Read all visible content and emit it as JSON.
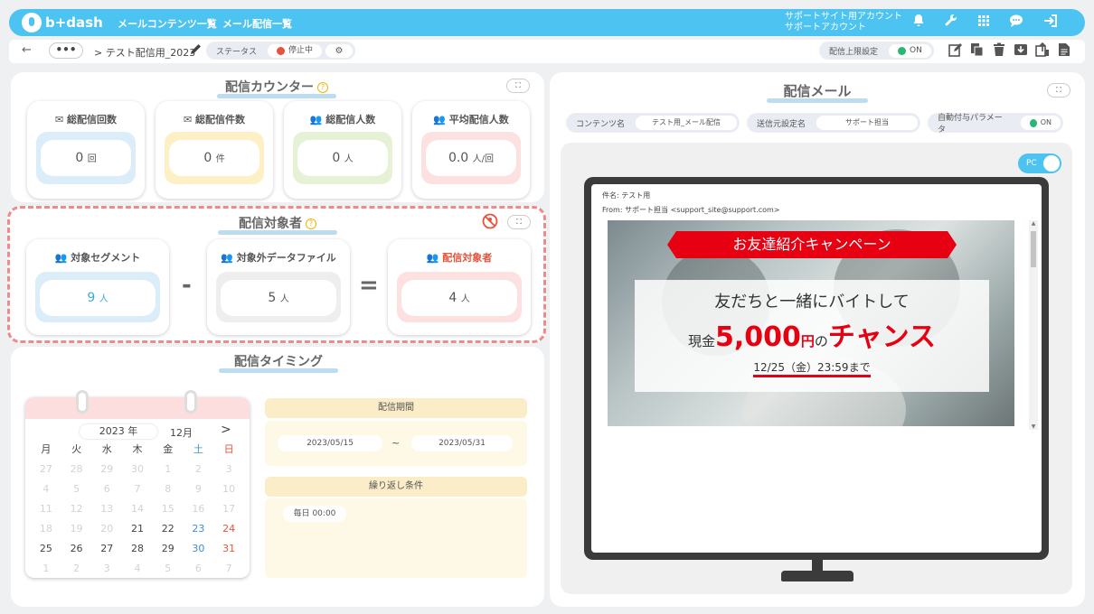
{
  "app": {
    "logo_text": "b+dash"
  },
  "nav": {
    "items": [
      {
        "label": "メールコンテンツ一覧"
      },
      {
        "label": "メール配信一覧"
      }
    ],
    "account_line1": "サポートサイト用アカウント",
    "account_line2": "サポートアカウント",
    "icons": [
      "bell-icon",
      "wrench-icon",
      "grid-icon",
      "chat-icon",
      "logout-icon"
    ]
  },
  "subbar": {
    "dots": "•••",
    "breadcrumb": "> テスト配信用_2023",
    "status_label": "ステータス",
    "status_value": "停止中",
    "limit_label": "配信上限設定",
    "limit_value": "ON",
    "tool_icons": [
      "edit-icon",
      "copy-icon",
      "trash-icon",
      "download-icon",
      "export-icon",
      "document-icon"
    ]
  },
  "counter": {
    "title": "配信カウンター",
    "cards": [
      {
        "label": "総配信回数",
        "value": "0",
        "unit": "回",
        "color": "#dcedfa",
        "icon": "mail-icon"
      },
      {
        "label": "総配信件数",
        "value": "0",
        "unit": "件",
        "color": "#fdf0c7",
        "icon": "mail-icon"
      },
      {
        "label": "総配信人数",
        "value": "0",
        "unit": "人",
        "color": "#e7f1d6",
        "icon": "users-icon"
      },
      {
        "label": "平均配信人数",
        "value": "0.0",
        "unit": "人/回",
        "color": "#fde0e0",
        "icon": "users-icon"
      }
    ]
  },
  "targets": {
    "title": "配信対象者",
    "cards": [
      {
        "label": "対象セグメント",
        "value": "9",
        "unit": "人",
        "color": "#dcedfa",
        "text_color": "#3aa8e0"
      },
      {
        "label": "対象外データファイル",
        "value": "5",
        "unit": "人",
        "color": "#eeeeee",
        "text_color": "#555555"
      },
      {
        "label": "配信対象者",
        "value": "4",
        "unit": "人",
        "color": "#fde0e0",
        "text_color": "#555555",
        "label_color": "#e5533c"
      }
    ],
    "minus": "-",
    "equals": "="
  },
  "timing": {
    "title": "配信タイミング",
    "calendar": {
      "year": "2023 年",
      "month": "12月",
      "next": ">",
      "weekdays": [
        "月",
        "火",
        "水",
        "木",
        "金",
        "土",
        "日"
      ],
      "rows": [
        [
          "27",
          "28",
          "29",
          "30",
          "1",
          "2",
          "3"
        ],
        [
          "4",
          "5",
          "6",
          "7",
          "8",
          "9",
          "10"
        ],
        [
          "11",
          "12",
          "13",
          "14",
          "15",
          "16",
          "17"
        ],
        [
          "18",
          "19",
          "20",
          "21",
          "22",
          "23",
          "24"
        ],
        [
          "25",
          "26",
          "27",
          "28",
          "29",
          "30",
          "31"
        ],
        [
          "1",
          "2",
          "3",
          "4",
          "5",
          "6",
          "7"
        ]
      ]
    },
    "period_label": "配信期間",
    "period_start": "2023/05/15",
    "period_sep": "~",
    "period_end": "2023/05/31",
    "repeat_label": "繰り返し条件",
    "repeat_value": "毎日 00:00"
  },
  "mail": {
    "title": "配信メール",
    "content_label": "コンテンツ名",
    "content_value": "テスト用_メール配信",
    "sender_label": "送信元設定名",
    "sender_value": "サポート担当",
    "param_label": "自動付与パラメータ",
    "param_value": "ON",
    "toggle_label": "PC",
    "subject": "件名: テスト用",
    "from": "From: サポート担当 <support_site@support.com>",
    "banner": "お友達紹介キャンペーン",
    "line1": "友だちと一緒にバイトして",
    "line2_a": "現金",
    "line2_b": "5,000",
    "line2_c": "円",
    "line2_d": "の",
    "line2_e": "チャンス",
    "line3": "12/25（金）23:59まで"
  }
}
